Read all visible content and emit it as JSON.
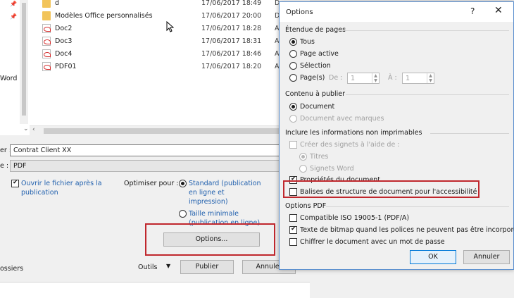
{
  "colors": {
    "accent": "#0078d7",
    "highlight": "#c0272d",
    "link": "#1f5fad"
  },
  "nav": {
    "fragment": "Word"
  },
  "files": [
    {
      "name": "d",
      "date": "17/06/2017 18:49",
      "type": "D",
      "icon": "folder-icon"
    },
    {
      "name": "Modèles Office personnalisés",
      "date": "17/06/2017 20:00",
      "type": "D",
      "icon": "folder-icon"
    },
    {
      "name": "Doc2",
      "date": "17/06/2017 18:28",
      "type": "A",
      "icon": "pdf-icon"
    },
    {
      "name": "Doc3",
      "date": "17/06/2017 18:31",
      "type": "A",
      "icon": "pdf-icon"
    },
    {
      "name": "Doc4",
      "date": "17/06/2017 18:46",
      "type": "A",
      "icon": "pdf-icon"
    },
    {
      "name": "PDF01",
      "date": "17/06/2017 18:20",
      "type": "A",
      "icon": "pdf-icon"
    }
  ],
  "save": {
    "filename_label": "er :",
    "filename_value": "Contrat Client XX",
    "type_label": "e :",
    "type_value": "PDF",
    "open_after_label": "Ouvrir le fichier après la publication",
    "optimize_label": "Optimiser pour :",
    "standard_label": "Standard (publication en ligne et impression)",
    "minimal_label": "Taille minimale (publication en ligne)",
    "options_button": "Options...",
    "folders_label": "ossiers",
    "tools_label": "Outils",
    "publish_button": "Publier",
    "cancel_button": "Annuler"
  },
  "options_dialog": {
    "title": "Options",
    "help_glyph": "?",
    "close_glyph": "✕",
    "page_range": {
      "heading": "Étendue de pages",
      "all": "Tous",
      "current": "Page active",
      "selection": "Sélection",
      "pages": "Page(s)",
      "from_label": "De :",
      "from_value": "1",
      "to_label": "À :",
      "to_value": "1"
    },
    "publish": {
      "heading": "Contenu à publier",
      "document": "Document",
      "markup": "Document avec marques"
    },
    "nonprint": {
      "heading": "Inclure les informations non imprimables",
      "bookmarks": "Créer des signets à l'aide de :",
      "headings": "Titres",
      "word_bookmarks": "Signets Word",
      "properties": "Propriétés du document",
      "structure_tags": "Balises de structure de document pour l'accessibilité"
    },
    "pdf": {
      "heading": "Options PDF",
      "iso": "Compatible ISO 19005-1 (PDF/A)",
      "bitmap": "Texte de bitmap quand les polices ne peuvent pas être incorporées",
      "encrypt": "Chiffrer le document avec un mot de passe"
    },
    "ok_button": "OK",
    "cancel_button": "Annuler"
  }
}
